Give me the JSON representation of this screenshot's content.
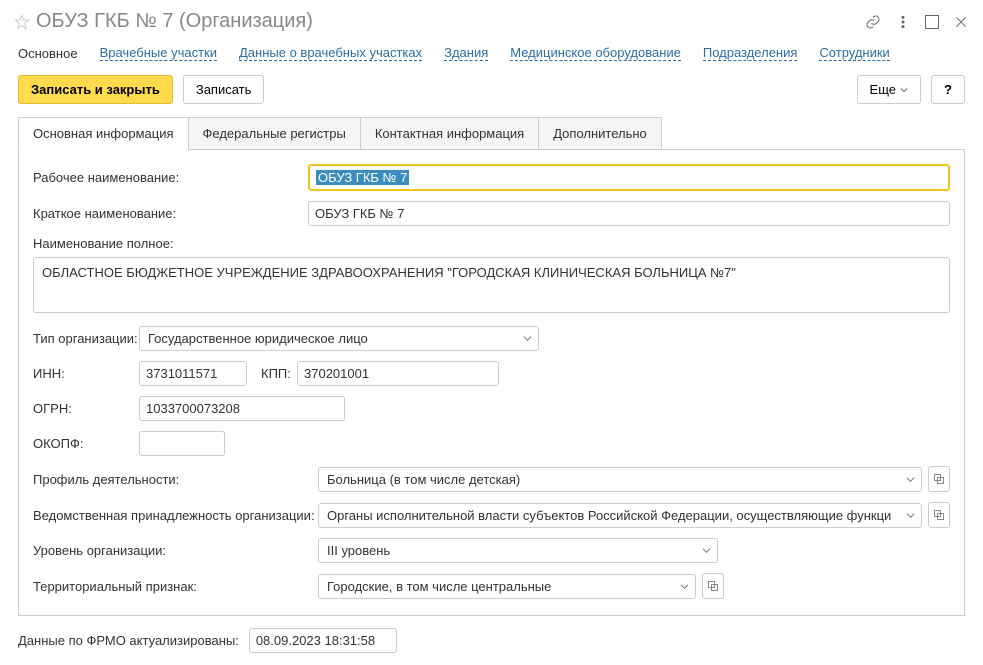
{
  "title": "ОБУЗ ГКБ № 7 (Организация)",
  "nav": {
    "main": "Основное",
    "areas": "Врачебные участки",
    "area_data": "Данные о врачебных участках",
    "buildings": "Здания",
    "equipment": "Медицинское оборудование",
    "departments": "Подразделения",
    "employees": "Сотрудники"
  },
  "toolbar": {
    "save_close": "Записать и закрыть",
    "save": "Записать",
    "more": "Еще",
    "help": "?"
  },
  "tabs": {
    "main": "Основная информация",
    "federal": "Федеральные регистры",
    "contact": "Контактная информация",
    "extra": "Дополнительно"
  },
  "form": {
    "work_name_label": "Рабочее наименование:",
    "work_name": "ОБУЗ ГКБ № 7",
    "short_name_label": "Краткое наименование:",
    "short_name": "ОБУЗ ГКБ № 7",
    "full_name_label": "Наименование полное:",
    "full_name": "ОБЛАСТНОЕ БЮДЖЕТНОЕ УЧРЕЖДЕНИЕ ЗДРАВООХРАНЕНИЯ \"ГОРОДСКАЯ КЛИНИЧЕСКАЯ БОЛЬНИЦА №7\"",
    "org_type_label": "Тип организации:",
    "org_type": "Государственное юридическое лицо",
    "inn_label": "ИНН:",
    "inn": "3731011571",
    "kpp_label": "КПП:",
    "kpp": "370201001",
    "ogrn_label": "ОГРН:",
    "ogrn": "1033700073208",
    "okopf_label": "ОКОПФ:",
    "okopf": "",
    "profile_label": "Профиль деятельности:",
    "profile": "Больница (в том числе детская)",
    "agency_label": "Ведомственная принадлежность организации:",
    "agency": "Органы исполнительной власти субъектов Российской Федерации, осуществляющие функции в об",
    "level_label": "Уровень организации:",
    "level": "III уровень",
    "territory_label": "Территориальный признак:",
    "territory": "Городские, в том числе центральные"
  },
  "footer": {
    "label": "Данные по ФРМО актуализированы:",
    "date": "08.09.2023 18:31:58"
  }
}
